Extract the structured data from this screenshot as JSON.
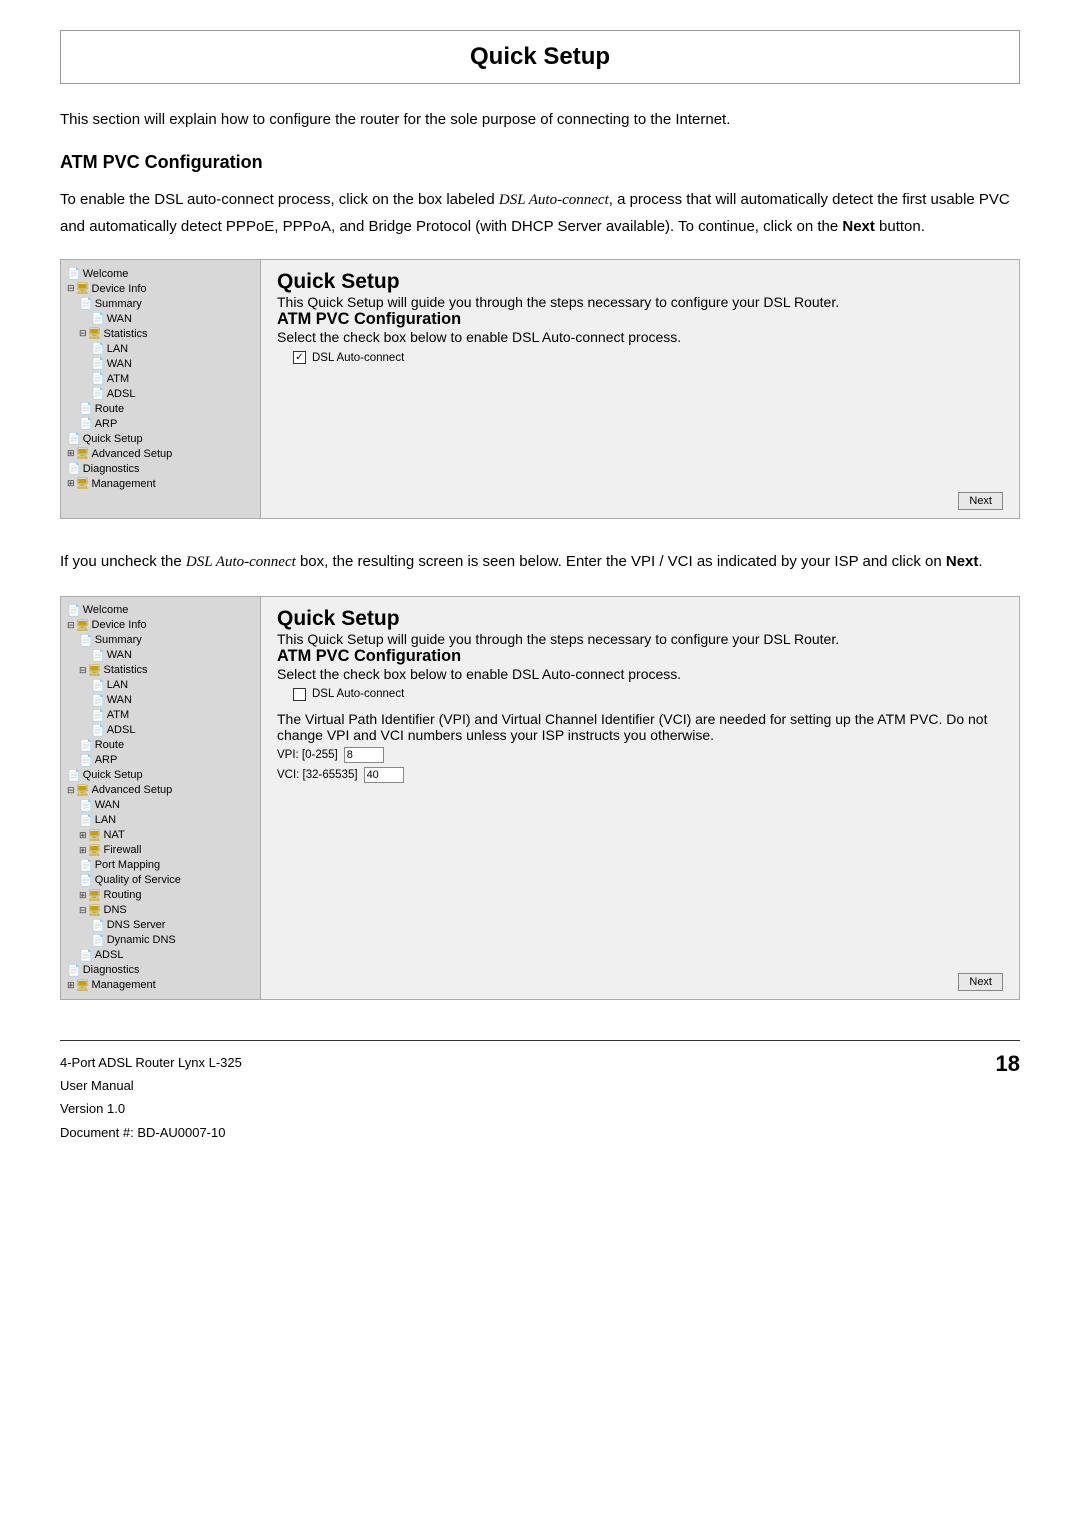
{
  "title": "Quick Setup",
  "intro": "This section will explain how to configure the router for the sole purpose of connecting to the Internet.",
  "atm_heading": "ATM PVC Configuration",
  "body1": {
    "prefix": "To enable the DSL auto-connect process, click on the box labeled ",
    "term": "DSL Auto-connect",
    "middle": ", a process that will automatically detect the first usable PVC and automatically detect PPPoE, PPPoA, and Bridge Protocol (with DHCP Server available).  To continue, click on the ",
    "bold": "Next",
    "suffix": " button."
  },
  "panel1": {
    "title": "Quick Setup",
    "description": "This Quick Setup will guide you through the steps necessary to configure your DSL Router.",
    "atm_heading": "ATM PVC Configuration",
    "checkbox_label": "Select the check box below to enable DSL Auto-connect process.",
    "checkbox_text": "DSL Auto-connect",
    "checked": true,
    "next_btn": "Next"
  },
  "body2": {
    "prefix": "If you uncheck the ",
    "term": "DSL Auto-connect",
    "middle": " box, the resulting screen is seen below.  Enter the VPI / VCI as indicated by your ISP and click on ",
    "bold": "Next",
    "suffix": "."
  },
  "panel2": {
    "title": "Quick Setup",
    "description": "This Quick Setup will guide you through the steps necessary to configure your DSL Router.",
    "atm_heading": "ATM PVC Configuration",
    "checkbox_label": "Select the check box below to enable DSL Auto-connect process.",
    "checkbox_text": "DSL Auto-connect",
    "checked": false,
    "vpi_note": "The Virtual Path Identifier (VPI) and Virtual Channel Identifier (VCI) are needed for setting up the ATM PVC. Do not change VPI and VCI numbers unless your ISP instructs you otherwise.",
    "vpi_label": "VPI: [0-255]",
    "vpi_value": "8",
    "vci_label": "VCI: [32-65535]",
    "vci_value": "40",
    "next_btn": "Next"
  },
  "sidebar1": {
    "items": [
      {
        "level": 0,
        "label": "Welcome",
        "type": "page",
        "expand": ""
      },
      {
        "level": 0,
        "label": "Device Info",
        "type": "folder",
        "expand": "⊟"
      },
      {
        "level": 1,
        "label": "Summary",
        "type": "page"
      },
      {
        "level": 2,
        "label": "WAN",
        "type": "page"
      },
      {
        "level": 1,
        "label": "Statistics",
        "type": "folder",
        "expand": "⊟"
      },
      {
        "level": 2,
        "label": "LAN",
        "type": "page"
      },
      {
        "level": 2,
        "label": "WAN",
        "type": "page"
      },
      {
        "level": 2,
        "label": "ATM",
        "type": "page"
      },
      {
        "level": 2,
        "label": "ADSL",
        "type": "page"
      },
      {
        "level": 1,
        "label": "Route",
        "type": "page"
      },
      {
        "level": 1,
        "label": "ARP",
        "type": "page"
      },
      {
        "level": 0,
        "label": "Quick Setup",
        "type": "page"
      },
      {
        "level": 0,
        "label": "Advanced Setup",
        "type": "folder",
        "expand": "⊞"
      },
      {
        "level": 0,
        "label": "Diagnostics",
        "type": "page"
      },
      {
        "level": 0,
        "label": "Management",
        "type": "folder",
        "expand": "⊞"
      }
    ]
  },
  "sidebar2": {
    "items": [
      {
        "level": 0,
        "label": "Welcome",
        "type": "page"
      },
      {
        "level": 0,
        "label": "Device Info",
        "type": "folder",
        "expand": "⊟"
      },
      {
        "level": 1,
        "label": "Summary",
        "type": "page"
      },
      {
        "level": 2,
        "label": "WAN",
        "type": "page"
      },
      {
        "level": 1,
        "label": "Statistics",
        "type": "folder",
        "expand": "⊟"
      },
      {
        "level": 2,
        "label": "LAN",
        "type": "page"
      },
      {
        "level": 2,
        "label": "WAN",
        "type": "page"
      },
      {
        "level": 2,
        "label": "ATM",
        "type": "page"
      },
      {
        "level": 2,
        "label": "ADSL",
        "type": "page"
      },
      {
        "level": 1,
        "label": "Route",
        "type": "page"
      },
      {
        "level": 1,
        "label": "ARP",
        "type": "page"
      },
      {
        "level": 0,
        "label": "Quick Setup",
        "type": "page"
      },
      {
        "level": 0,
        "label": "Advanced Setup",
        "type": "folder",
        "expand": "⊟"
      },
      {
        "level": 1,
        "label": "WAN",
        "type": "page"
      },
      {
        "level": 1,
        "label": "LAN",
        "type": "page"
      },
      {
        "level": 1,
        "label": "NAT",
        "type": "folder",
        "expand": "⊞"
      },
      {
        "level": 1,
        "label": "Firewall",
        "type": "folder",
        "expand": "⊞"
      },
      {
        "level": 1,
        "label": "Port Mapping",
        "type": "page"
      },
      {
        "level": 1,
        "label": "Quality of Service",
        "type": "page"
      },
      {
        "level": 1,
        "label": "Routing",
        "type": "folder",
        "expand": "⊞"
      },
      {
        "level": 1,
        "label": "DNS",
        "type": "folder",
        "expand": "⊟"
      },
      {
        "level": 2,
        "label": "DNS Server",
        "type": "page"
      },
      {
        "level": 2,
        "label": "Dynamic DNS",
        "type": "page"
      },
      {
        "level": 1,
        "label": "ADSL",
        "type": "page"
      },
      {
        "level": 0,
        "label": "Diagnostics",
        "type": "page"
      },
      {
        "level": 0,
        "label": "Management",
        "type": "folder",
        "expand": "⊞"
      }
    ]
  },
  "footer": {
    "product": "4-Port ADSL Router Lynx L-325",
    "manual": "User Manual",
    "version": "Version 1.0",
    "document": "Document #: BD-AU0007-10",
    "page": "18"
  }
}
